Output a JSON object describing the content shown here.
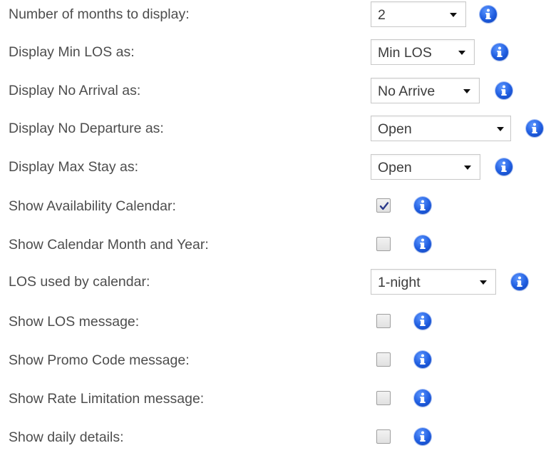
{
  "settings": [
    {
      "label": "Number of months to display:",
      "control": "select",
      "value": "2",
      "info_icon": "info-icon"
    },
    {
      "label": "Display Min LOS as:",
      "control": "select",
      "value": "Min LOS",
      "info_icon": "info-icon"
    },
    {
      "label": "Display No Arrival as:",
      "control": "select",
      "value": "No Arrive",
      "info_icon": "info-icon"
    },
    {
      "label": "Display No Departure as:",
      "control": "select",
      "value": "Open",
      "info_icon": "info-icon"
    },
    {
      "label": "Display Max Stay as:",
      "control": "select",
      "value": "Open",
      "info_icon": "info-icon"
    },
    {
      "label": "Show Availability Calendar:",
      "control": "checkbox",
      "checked": true,
      "info_icon": "info-icon"
    },
    {
      "label": "Show Calendar Month and Year:",
      "control": "checkbox",
      "checked": false,
      "info_icon": "info-icon"
    },
    {
      "label": "LOS used by calendar:",
      "control": "select",
      "value": "1-night",
      "info_icon": "info-icon"
    },
    {
      "label": "Show LOS message:",
      "control": "checkbox",
      "checked": false,
      "info_icon": "info-icon"
    },
    {
      "label": "Show Promo Code message:",
      "control": "checkbox",
      "checked": false,
      "info_icon": "info-icon"
    },
    {
      "label": "Show Rate Limitation message:",
      "control": "checkbox",
      "checked": false,
      "info_icon": "info-icon"
    },
    {
      "label": "Show daily details:",
      "control": "checkbox",
      "checked": false,
      "info_icon": "info-icon"
    }
  ],
  "colors": {
    "info_icon": "#1f5de0",
    "checkmark": "#2b3a8a",
    "label_text": "#4d4d4d"
  }
}
